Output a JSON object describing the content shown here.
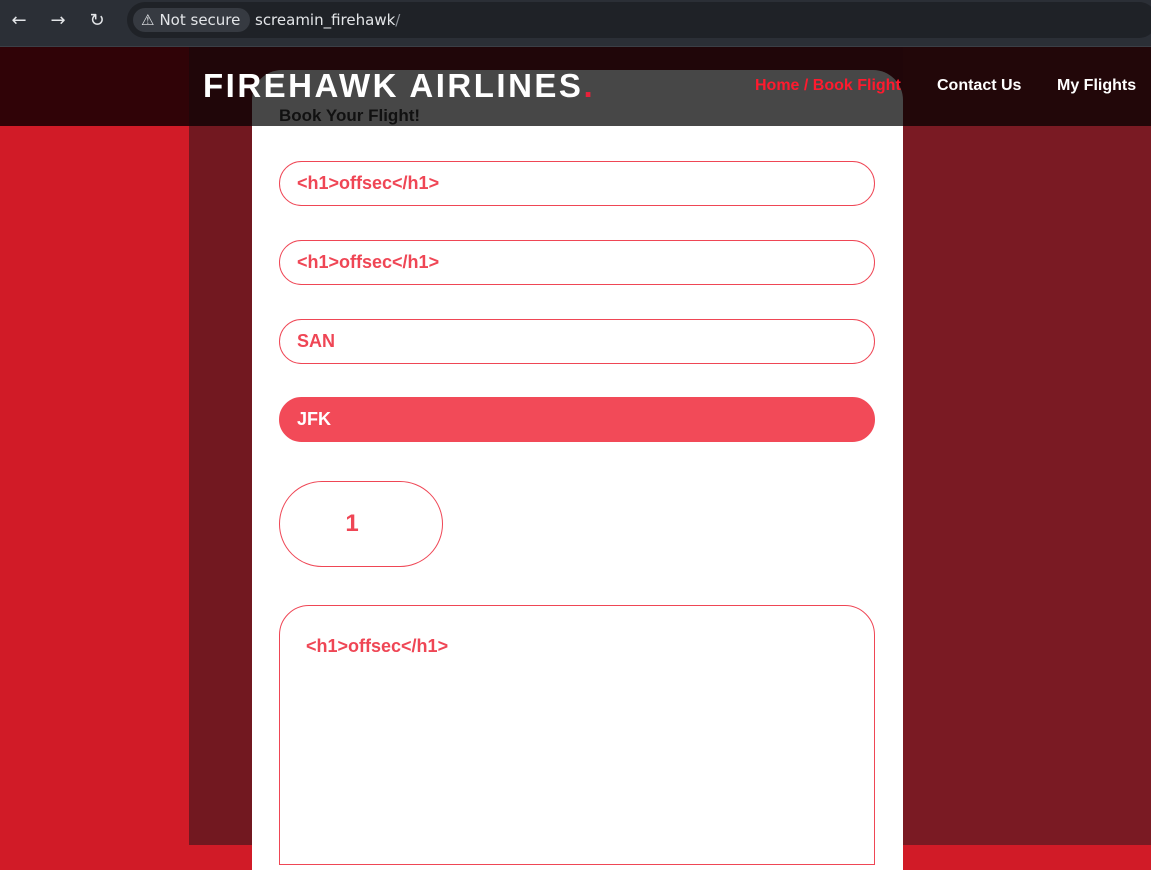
{
  "browser": {
    "back_icon": "arrow-left-icon",
    "forward_icon": "arrow-right-icon",
    "reload_icon": "reload-icon",
    "security_label": "Not secure",
    "security_icon": "warning-triangle-icon",
    "url": "screamin_firehawk",
    "url_suffix": "/"
  },
  "header": {
    "brand": "FIREHAWK AIRLINES",
    "brand_dot": ".",
    "nav": [
      {
        "label": "Home / Book Flight",
        "active": true
      },
      {
        "label": "Contact Us",
        "active": false
      },
      {
        "label": "My Flights",
        "active": false
      }
    ]
  },
  "form": {
    "title": "Book Your Flight!",
    "first_name_value": "<h1>offsec</h1>",
    "last_name_value": "<h1>offsec</h1>",
    "origin_value": "SAN",
    "destination_value": "JFK",
    "passengers_value": "1",
    "notes_value": "<h1>offsec</h1>"
  },
  "colors": {
    "accent": "#ef4655",
    "active_nav": "#ff1a2e",
    "page_red": "#d11b27",
    "page_dark": "#721820"
  }
}
